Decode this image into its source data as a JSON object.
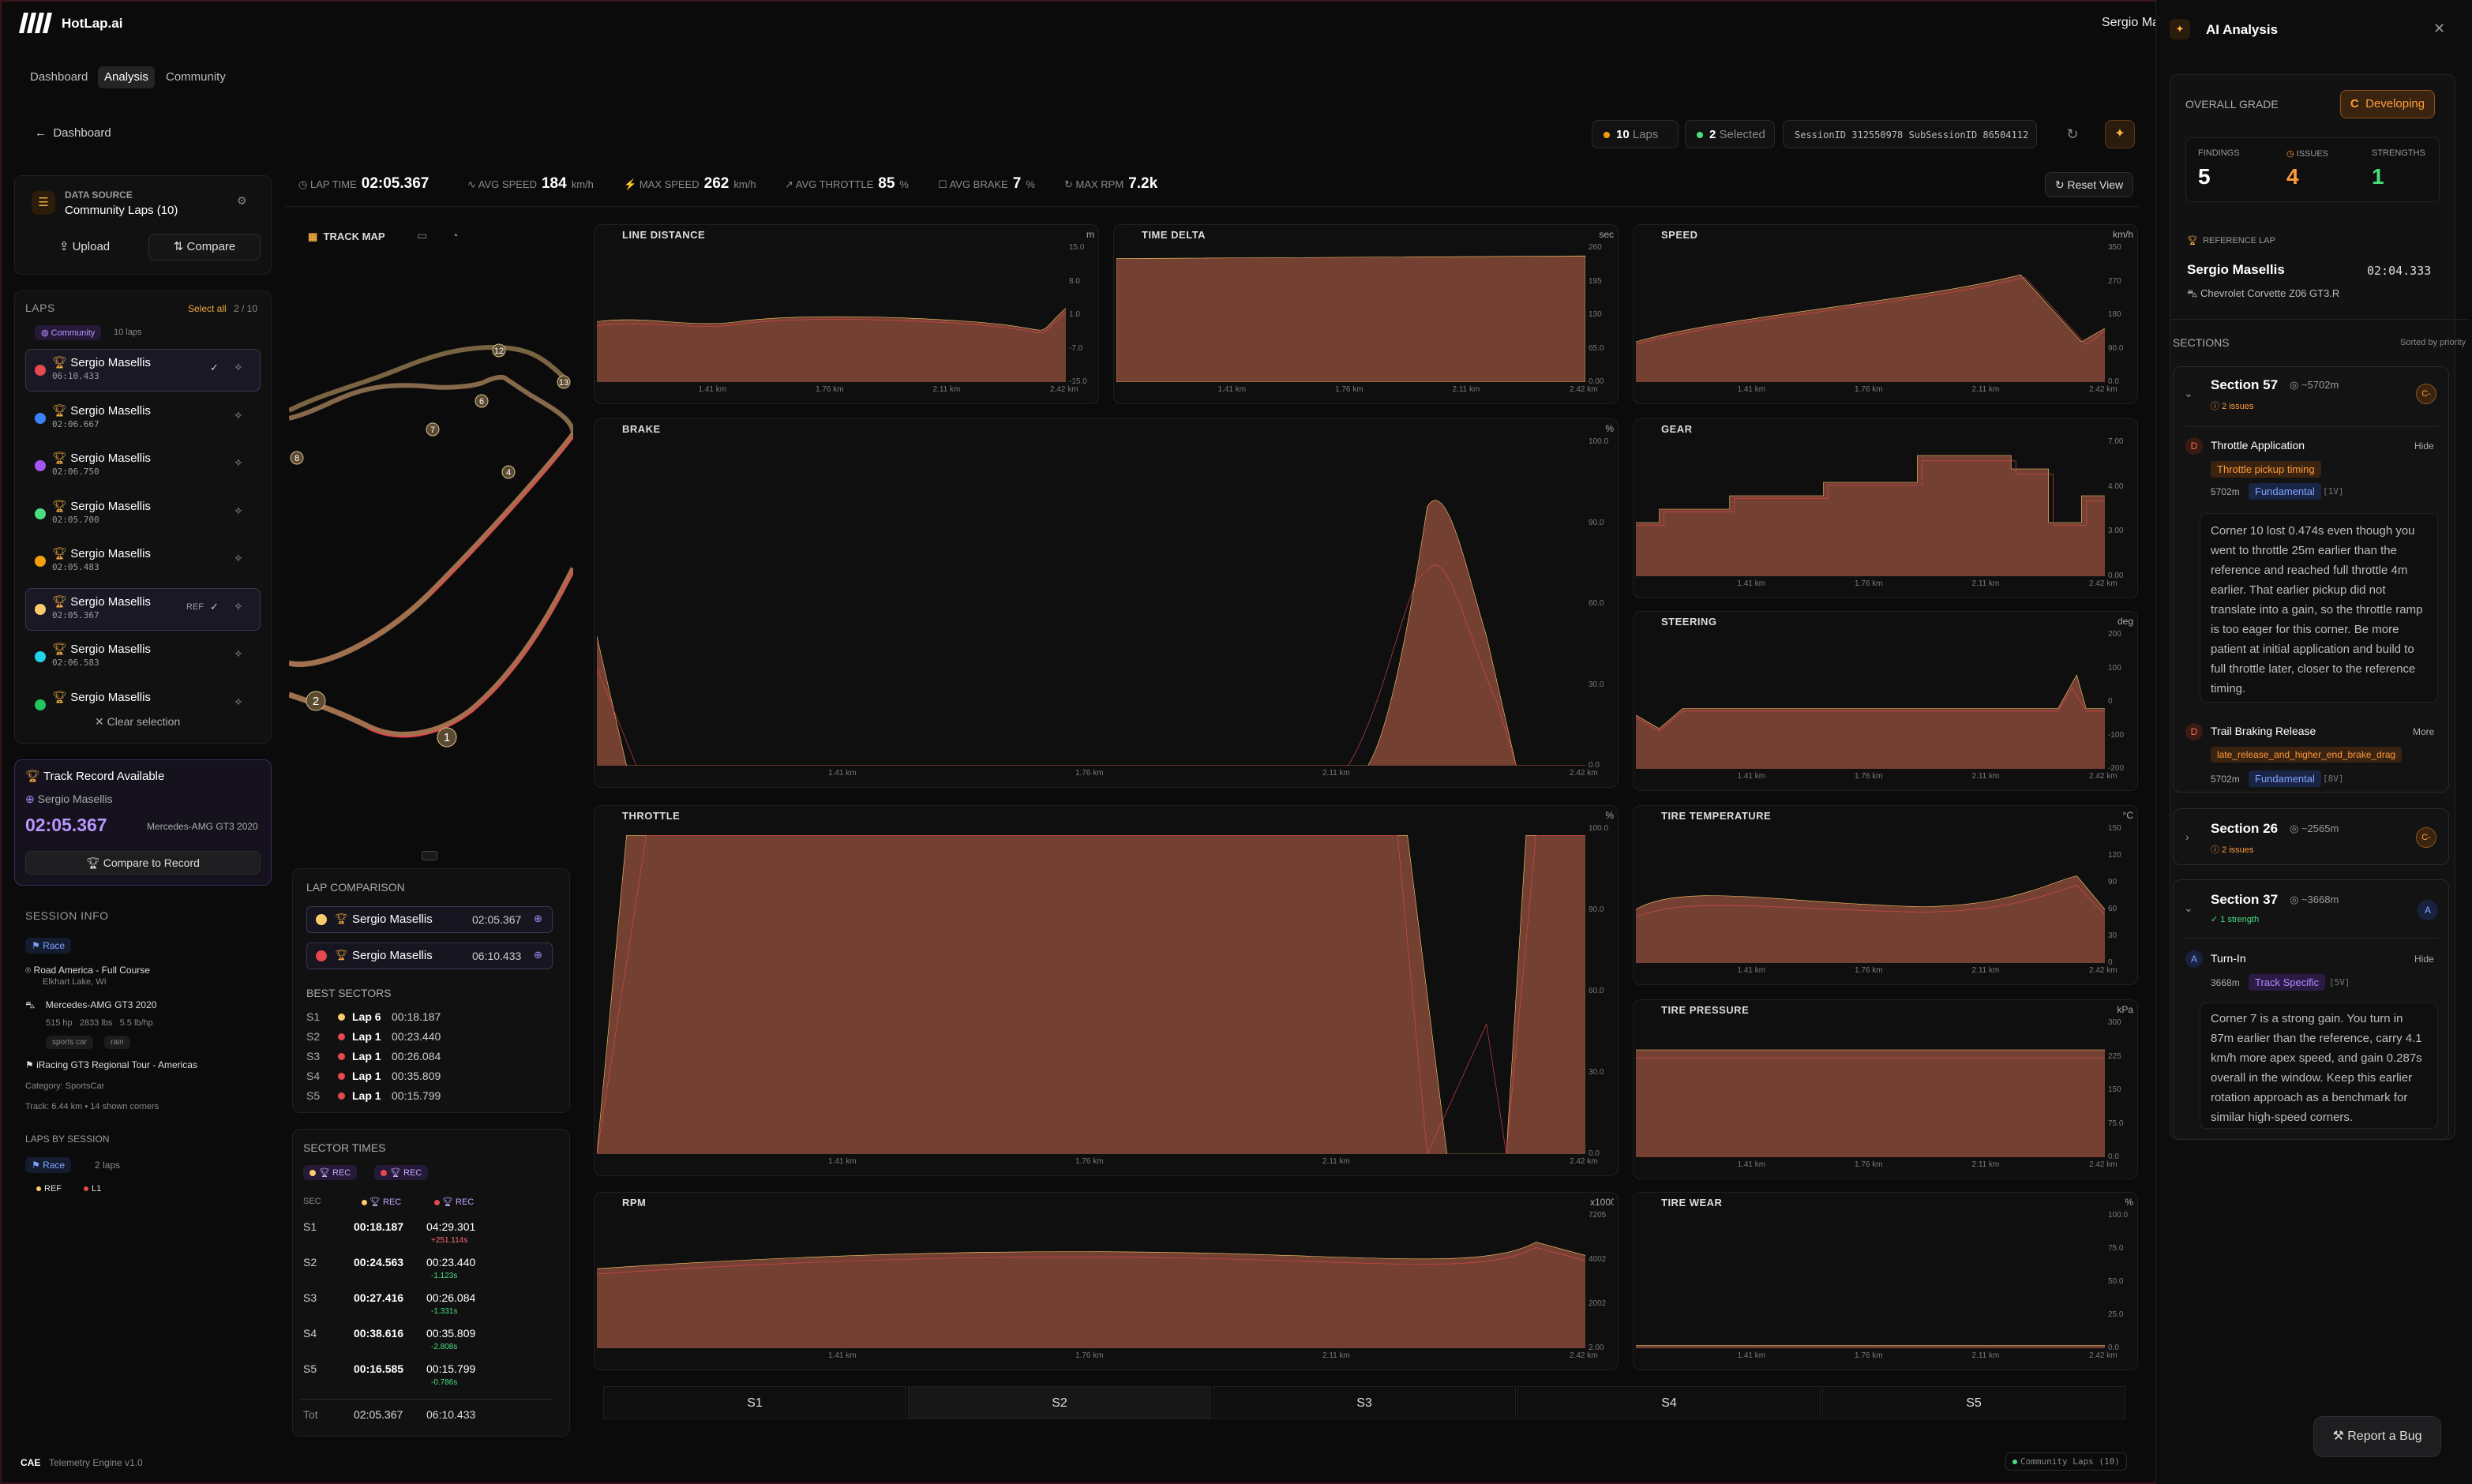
{
  "app": {
    "brand": "HotLap.ai",
    "user": "Sergio Ma"
  },
  "nav": {
    "dashboard": "Dashboard",
    "analysis": "Analysis",
    "community": "Community",
    "back": "Dashboard"
  },
  "header": {
    "laps_count": "10",
    "laps_label": "Laps",
    "selected_count": "2",
    "selected_label": "Selected",
    "session_id": "SessionID 312550978  SubSessionID 86504112"
  },
  "stats": {
    "lap_time_label": "LAP TIME",
    "lap_time": "02:05.367",
    "avg_speed_label": "AVG SPEED",
    "avg_speed": "184",
    "avg_speed_unit": "km/h",
    "max_speed_label": "MAX SPEED",
    "max_speed": "262",
    "max_speed_unit": "km/h",
    "avg_throttle_label": "AVG THROTTLE",
    "avg_throttle": "85",
    "avg_throttle_unit": "%",
    "avg_brake_label": "AVG BRAKE",
    "avg_brake": "7",
    "avg_brake_unit": "%",
    "max_rpm_label": "MAX RPM",
    "max_rpm": "7.2k",
    "reset_view": "Reset View"
  },
  "datasource": {
    "label": "DATA SOURCE",
    "value": "Community Laps (10)",
    "upload": "Upload",
    "compare": "Compare"
  },
  "laps": {
    "title": "LAPS",
    "select_all": "Select all",
    "count": "2 / 10",
    "filter_tag": "Community",
    "filter_count": "10 laps",
    "ref_label": "REF",
    "items": [
      {
        "name": "Sergio Masellis",
        "time": "06:10.433",
        "color": "#e5484d",
        "selected": true
      },
      {
        "name": "Sergio Masellis",
        "time": "02:06.667",
        "color": "#3b82f6",
        "selected": false
      },
      {
        "name": "Sergio Masellis",
        "time": "02:06.750",
        "color": "#a855f7",
        "selected": false
      },
      {
        "name": "Sergio Masellis",
        "time": "02:05.700",
        "color": "#4ade80",
        "selected": false
      },
      {
        "name": "Sergio Masellis",
        "time": "02:05.483",
        "color": "#f59e0b",
        "selected": false
      },
      {
        "name": "Sergio Masellis",
        "time": "02:05.367",
        "color": "#facc6b",
        "selected": true
      },
      {
        "name": "Sergio Masellis",
        "time": "02:06.583",
        "color": "#22d3ee",
        "selected": false
      },
      {
        "name": "Sergio Masellis",
        "time": "",
        "color": "#22c55e",
        "selected": false
      }
    ],
    "clear": "Clear selection"
  },
  "record": {
    "title": "Track Record Available",
    "driver": "Sergio Masellis",
    "time": "02:05.367",
    "car": "Mercedes-AMG GT3 2020",
    "button": "Compare to Record"
  },
  "session": {
    "title": "SESSION INFO",
    "type": "Race",
    "track": "Road America - Full Course",
    "location": "Elkhart Lake, WI",
    "car": "Mercedes-AMG GT3 2020",
    "hp": "515 hp",
    "weight": "2833 lbs",
    "ratio": "5.5 lb/hp",
    "tags": [
      "sports car",
      "rain"
    ],
    "series": "iRacing GT3 Regional Tour - Americas",
    "category": "Category: SportsCar",
    "track_info": "Track: 6.44 km • 14 shown corners",
    "laps_by_session": "LAPS BY SESSION",
    "race_label": "Race",
    "race_laps": "2 laps",
    "ref": "REF",
    "l1": "L1"
  },
  "trackmap": {
    "title": "TRACK MAP",
    "corners": [
      "12",
      "13",
      "7",
      "6",
      "8",
      "4",
      "2",
      "1"
    ]
  },
  "lap_comparison": {
    "title": "LAP COMPARISON",
    "laps": [
      {
        "name": "Sergio Masellis",
        "time": "02:05.367",
        "color": "#facc6b"
      },
      {
        "name": "Sergio Masellis",
        "time": "06:10.433",
        "color": "#e5484d"
      }
    ]
  },
  "best_sectors": {
    "title": "BEST SECTORS",
    "rows": [
      {
        "s": "S1",
        "lap": "Lap 6",
        "time": "00:18.187",
        "color": "#facc6b"
      },
      {
        "s": "S2",
        "lap": "Lap 1",
        "time": "00:23.440",
        "color": "#e5484d"
      },
      {
        "s": "S3",
        "lap": "Lap 1",
        "time": "00:26.084",
        "color": "#e5484d"
      },
      {
        "s": "S4",
        "lap": "Lap 1",
        "time": "00:35.809",
        "color": "#e5484d"
      },
      {
        "s": "S5",
        "lap": "Lap 1",
        "time": "00:15.799",
        "color": "#e5484d"
      }
    ]
  },
  "sector_times": {
    "title": "SECTOR TIMES",
    "rec": "REC",
    "sec_header": "SEC",
    "rows": [
      {
        "s": "S1",
        "a": "00:18.187",
        "b": "04:29.301",
        "delta": "+251.114s",
        "pos": false
      },
      {
        "s": "S2",
        "a": "00:24.563",
        "b": "00:23.440",
        "delta": "-1.123s",
        "pos": true
      },
      {
        "s": "S3",
        "a": "00:27.416",
        "b": "00:26.084",
        "delta": "-1.331s",
        "pos": true
      },
      {
        "s": "S4",
        "a": "00:38.616",
        "b": "00:35.809",
        "delta": "-2.808s",
        "pos": true
      },
      {
        "s": "S5",
        "a": "00:16.585",
        "b": "00:15.799",
        "delta": "-0.786s",
        "pos": true
      }
    ],
    "total_label": "Tot",
    "total_a": "02:05.367",
    "total_b": "06:10.433"
  },
  "charts": {
    "line_distance": {
      "title": "LINE DISTANCE",
      "unit": "m",
      "yticks": [
        "15.0",
        "8.0",
        "1.0",
        "-7.0",
        "-15.0"
      ]
    },
    "time_delta": {
      "title": "TIME DELTA",
      "unit": "sec",
      "yticks": [
        "260",
        "195",
        "130",
        "65.0",
        "0.00"
      ]
    },
    "speed": {
      "title": "SPEED",
      "unit": "km/h",
      "yticks": [
        "350",
        "270",
        "180",
        "90.0",
        "0.0"
      ]
    },
    "brake": {
      "title": "BRAKE",
      "unit": "%",
      "yticks": [
        "100.0",
        "90.0",
        "60.0",
        "30.0",
        "0.0"
      ]
    },
    "gear": {
      "title": "GEAR",
      "unit": "",
      "yticks": [
        "7.00",
        "4.00",
        "3.00",
        "0.00"
      ]
    },
    "steering": {
      "title": "STEERING",
      "unit": "deg",
      "yticks": [
        "200",
        "100",
        "0",
        "-100",
        "-200"
      ]
    },
    "throttle": {
      "title": "THROTTLE",
      "unit": "%",
      "yticks": [
        "100.0",
        "90.0",
        "60.0",
        "30.0",
        "0.0"
      ]
    },
    "tire_temp": {
      "title": "TIRE TEMPERATURE",
      "unit": "°C",
      "yticks": [
        "150",
        "120",
        "90",
        "60",
        "30",
        "0"
      ]
    },
    "tire_pressure": {
      "title": "TIRE PRESSURE",
      "unit": "kPa",
      "yticks": [
        "300",
        "225",
        "150",
        "75.0",
        "0.0"
      ]
    },
    "rpm": {
      "title": "RPM",
      "unit": "x1000",
      "yticks": [
        "7205",
        "4002",
        "2002",
        "2.00"
      ]
    },
    "tire_wear": {
      "title": "TIRE WEAR",
      "unit": "%",
      "yticks": [
        "100.0",
        "75.0",
        "50.0",
        "25.0",
        "0.0"
      ]
    },
    "xticks": [
      "1.41 km",
      "1.76 km",
      "2.11 km",
      "2.42 km"
    ]
  },
  "sectors_tabs": [
    "S1",
    "S2",
    "S3",
    "S4",
    "S5"
  ],
  "footer": {
    "cae": "CAE",
    "engine": "Telemetry Engine v1.0",
    "community": "Community Laps (10)"
  },
  "ai": {
    "title": "AI Analysis",
    "overall": "OVERALL GRADE",
    "grade": "C",
    "grade_label": "Developing",
    "findings_label": "FINDINGS",
    "findings": "5",
    "issues_label": "ISSUES",
    "issues": "4",
    "strengths_label": "STRENGTHS",
    "strengths": "1",
    "ref_lap_label": "REFERENCE LAP",
    "ref_driver": "Sergio Masellis",
    "ref_time": "02:04.333",
    "ref_car": "Chevrolet Corvette Z06 GT3.R",
    "sections_label": "SECTIONS",
    "sorted": "Sorted by priority",
    "s57": {
      "title": "Section 57",
      "dist": "~5702m",
      "sub": "2 issues",
      "grade": "C-",
      "f1_sev": "D",
      "f1_title": "Throttle Application",
      "f1_action": "Hide",
      "f1_tag": "Throttle pickup timing",
      "f1_dist": "5702m",
      "f1_cat": "Fundamental",
      "f1_conf": "[1V]",
      "f1_text": "Corner 10 lost 0.474s even though you went to throttle 25m earlier than the reference and reached full throttle 4m earlier. That earlier pickup did not translate into a gain, so the throttle ramp is too eager for this corner. Be more patient at initial application and build to full throttle later, closer to the reference timing.",
      "f2_sev": "D",
      "f2_title": "Trail Braking Release",
      "f2_action": "More",
      "f2_tag": "late_release_and_higher_end_brake_drag",
      "f2_dist": "5702m",
      "f2_cat": "Fundamental",
      "f2_conf": "[8V]"
    },
    "s26": {
      "title": "Section 26",
      "dist": "~2565m",
      "sub": "2 issues",
      "grade": "C-"
    },
    "s37": {
      "title": "Section 37",
      "dist": "~3668m",
      "sub": "1 strength",
      "grade": "A",
      "f1_sev": "A",
      "f1_title": "Turn-In",
      "f1_action": "Hide",
      "f1_dist": "3668m",
      "f1_cat": "Track Specific",
      "f1_conf": "[5V]",
      "f1_text": "Corner 7 is a strong gain. You turn in 87m earlier than the reference, carry 4.1 km/h more apex speed, and gain 0.287s overall in the window. Keep this earlier rotation approach as a benchmark for similar high-speed corners."
    },
    "report": "Report a Bug"
  }
}
